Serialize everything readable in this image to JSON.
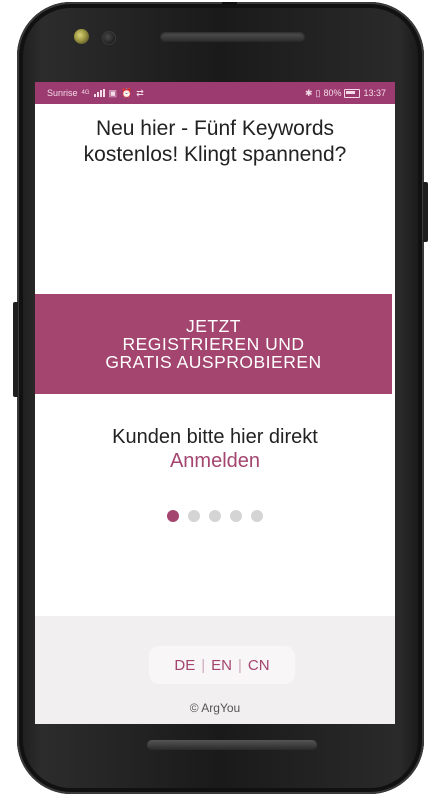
{
  "status_bar": {
    "carrier": "Sunrise",
    "network": "4G",
    "battery": "80%",
    "time": "13:37"
  },
  "headline": "Neu hier - Fünf Keywords kostenlos! Klingt spannend?",
  "cta": {
    "line1": "JETZT",
    "line2": "REGISTRIEREN UND",
    "line3": "GRATIS AUSPROBIEREN"
  },
  "login_prompt": {
    "text": "Kunden bitte hier direkt",
    "link": "Anmelden"
  },
  "pager": {
    "count": 5,
    "active_index": 0
  },
  "languages": [
    "DE",
    "EN",
    "CN"
  ],
  "copyright": "© ArgYou",
  "colors": {
    "accent": "#a3456f",
    "status_bar": "#9c3b70",
    "footer_bg": "#f1eff0"
  }
}
